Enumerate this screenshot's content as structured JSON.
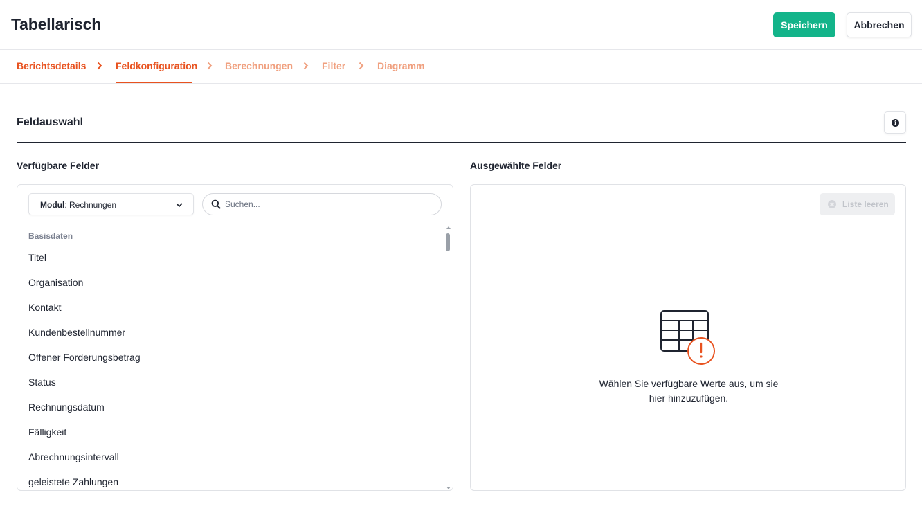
{
  "header": {
    "title": "Tabellarisch",
    "save_label": "Speichern",
    "cancel_label": "Abbrechen"
  },
  "stepper": {
    "steps": [
      {
        "label": "Berichtsdetails",
        "state": "done"
      },
      {
        "label": "Feldkonfiguration",
        "state": "active"
      },
      {
        "label": "Berechnungen",
        "state": "todo"
      },
      {
        "label": "Filter",
        "state": "todo"
      },
      {
        "label": "Diagramm",
        "state": "todo"
      }
    ]
  },
  "section": {
    "title": "Feldauswahl",
    "info_icon": "info-icon"
  },
  "available": {
    "title": "Verfügbare Felder",
    "module_label": "Modul",
    "module_value": ": Rechnungen",
    "search_placeholder": "Suchen...",
    "search_value": "",
    "group_label": "Basisdaten",
    "fields": [
      "Titel",
      "Organisation",
      "Kontakt",
      "Kundenbestellnummer",
      "Offener Forderungsbetrag",
      "Status",
      "Rechnungsdatum",
      "Fälligkeit",
      "Abrechnungsintervall",
      "geleistete Zahlungen"
    ]
  },
  "selected": {
    "title": "Ausgewählte Felder",
    "clear_label": "Liste leeren",
    "empty_line1": "Wählen Sie verfügbare Werte aus, um sie",
    "empty_line2": "hier hinzuzufügen."
  },
  "colors": {
    "accent": "#e8521f",
    "primary_button": "#13b48a",
    "text": "#1f2430"
  }
}
